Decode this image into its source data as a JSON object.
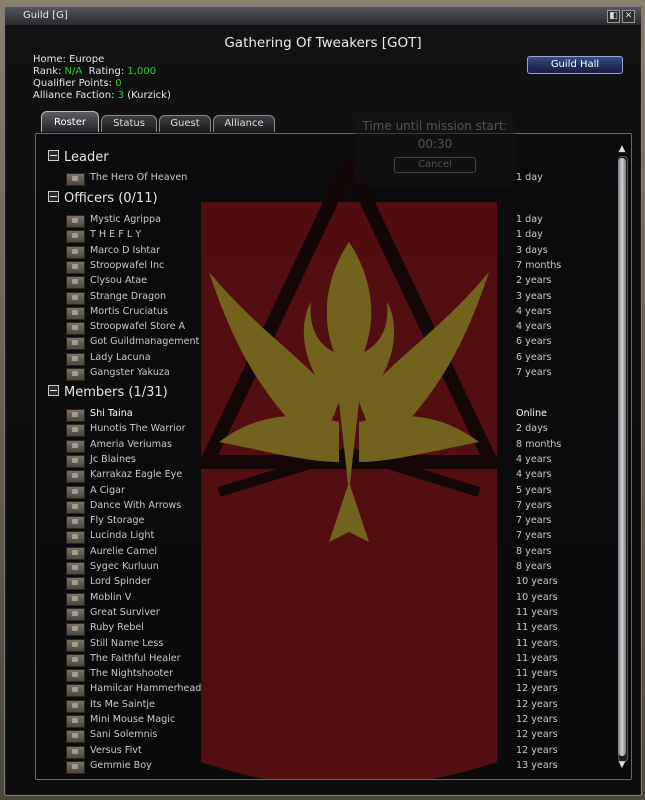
{
  "window": {
    "title": "Guild  [G]",
    "btn_min": "◧",
    "btn_close": "✕"
  },
  "guild": {
    "name": "Gathering Of Tweakers [GOT]",
    "home_label": "Home:",
    "home": "Europe",
    "rank_label": "Rank:",
    "rank": "N/A",
    "rating_label": "Rating:",
    "rating": "1,000",
    "qualifier_label": "Qualifier Points:",
    "qualifier": "0",
    "alliance_label": "Alliance Faction:",
    "alliance_points": "3",
    "alliance_faction": "(Kurzick)",
    "hall_button": "Guild Hall"
  },
  "tabs": [
    "Roster",
    "Status",
    "Guest",
    "Alliance"
  ],
  "timer": {
    "text": "Time until mission start:",
    "time": "00:30",
    "cancel": "Cancel"
  },
  "roster": {
    "leader_title": "Leader",
    "leader": [
      {
        "name": "The Hero Of Heaven",
        "status": "1 day"
      }
    ],
    "officers_title": "Officers (0/11)",
    "officers": [
      {
        "name": "Mystic Agrippa",
        "status": "1 day"
      },
      {
        "name": "T H E F L Y",
        "status": "1 day"
      },
      {
        "name": "Marco D Ishtar",
        "status": "3 days"
      },
      {
        "name": "Stroopwafel Inc",
        "status": "7 months"
      },
      {
        "name": "Clysou Atae",
        "status": "2 years"
      },
      {
        "name": "Strange Dragon",
        "status": "3 years"
      },
      {
        "name": "Mortis Cruciatus",
        "status": "4 years"
      },
      {
        "name": "Stroopwafel Store A",
        "status": "4 years"
      },
      {
        "name": "Got Guildmanagement",
        "status": "6 years"
      },
      {
        "name": "Lady Lacuna",
        "status": "6 years"
      },
      {
        "name": "Gangster Yakuza",
        "status": "7 years"
      }
    ],
    "members_title": "Members (1/31)",
    "members": [
      {
        "name": "Shi Taina",
        "status": "Online"
      },
      {
        "name": "Hunotis The Warrior",
        "status": "2 days"
      },
      {
        "name": "Ameria Veriumas",
        "status": "8 months"
      },
      {
        "name": "Jc Blaines",
        "status": "4 years"
      },
      {
        "name": "Karrakaz Eagle Eye",
        "status": "4 years"
      },
      {
        "name": "A Cigar",
        "status": "5 years"
      },
      {
        "name": "Dance With Arrows",
        "status": "7 years"
      },
      {
        "name": "Fly Storage",
        "status": "7 years"
      },
      {
        "name": "Lucinda Light",
        "status": "7 years"
      },
      {
        "name": "Aurelie Camel",
        "status": "8 years"
      },
      {
        "name": "Sygec Kurluun",
        "status": "8 years"
      },
      {
        "name": "Lord Spinder",
        "status": "10 years"
      },
      {
        "name": "Moblin V",
        "status": "10 years"
      },
      {
        "name": "Great Surviver",
        "status": "11 years"
      },
      {
        "name": "Ruby Rebel",
        "status": "11 years"
      },
      {
        "name": "Still Name Less",
        "status": "11 years"
      },
      {
        "name": "The Faithful Healer",
        "status": "11 years"
      },
      {
        "name": "The Nightshooter",
        "status": "11 years"
      },
      {
        "name": "Hamilcar Hammerhead",
        "status": "12 years"
      },
      {
        "name": "Its Me Saintje",
        "status": "12 years"
      },
      {
        "name": "Mini Mouse Magic",
        "status": "12 years"
      },
      {
        "name": "Sani Solemnis",
        "status": "12 years"
      },
      {
        "name": "Versus Fivt",
        "status": "12 years"
      },
      {
        "name": "Gemmie Boy",
        "status": "13 years"
      }
    ]
  },
  "colors": {
    "green": "#21d421",
    "button_blue": "#1f2a58",
    "banner_red": "#8f1216",
    "emblem_gold": "#c8a92e"
  }
}
